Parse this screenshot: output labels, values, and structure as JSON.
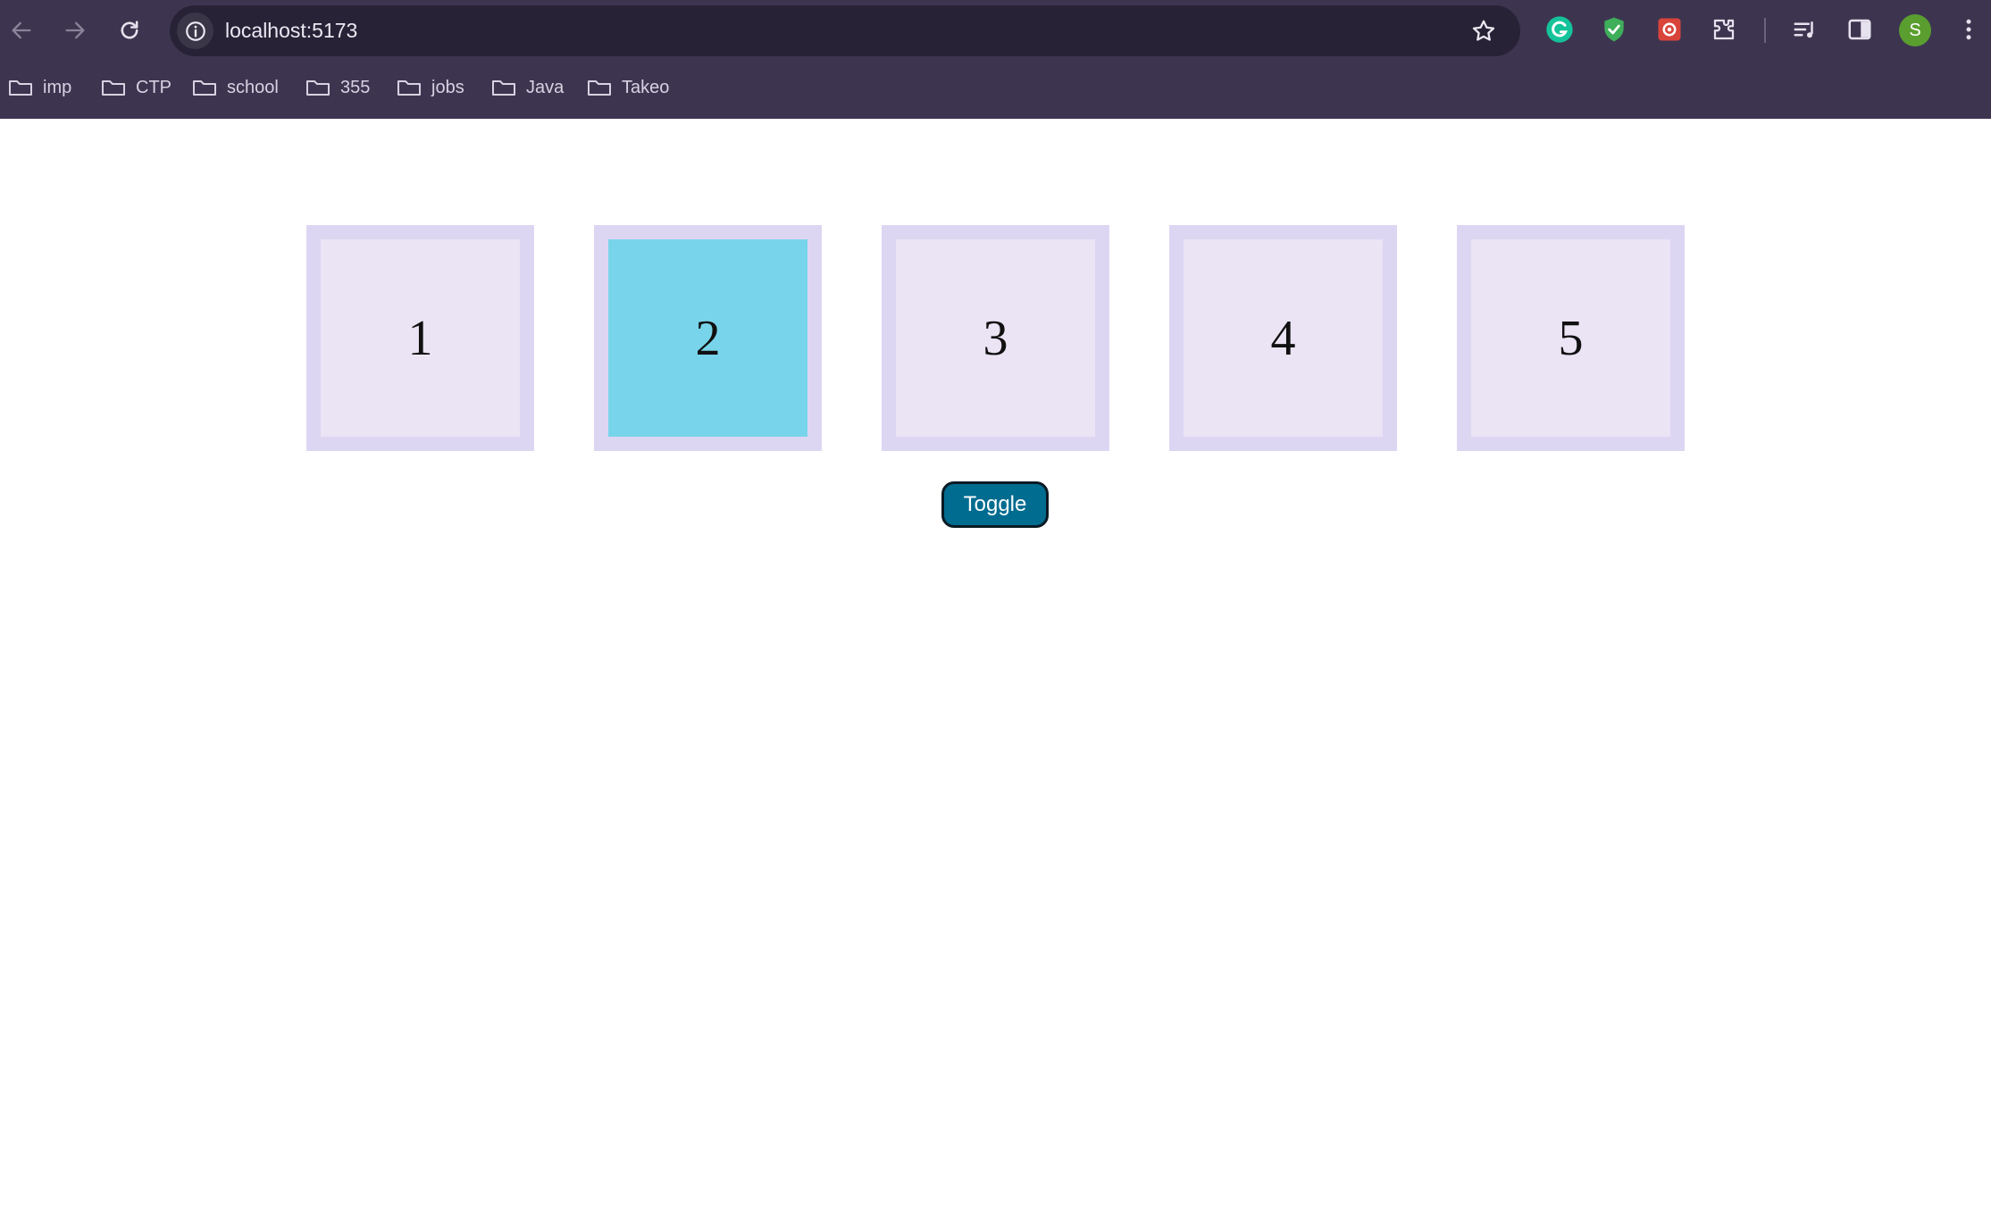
{
  "browser": {
    "url": "localhost:5173",
    "profile_initial": "S",
    "icons": [
      "back-arrow-icon",
      "forward-arrow-icon",
      "reload-icon",
      "site-info-icon",
      "bookmark-star-icon",
      "grammarly-icon",
      "shield-extension-icon",
      "red-extension-icon",
      "extensions-puzzle-icon",
      "reading-list-icon",
      "side-panel-icon",
      "menu-kebab-icon"
    ],
    "bookmarks": [
      {
        "label": "imp"
      },
      {
        "label": "CTP"
      },
      {
        "label": "school"
      },
      {
        "label": "355"
      },
      {
        "label": "jobs"
      },
      {
        "label": "Java"
      },
      {
        "label": "Takeo"
      }
    ]
  },
  "boxes": [
    {
      "label": "1",
      "active": false
    },
    {
      "label": "2",
      "active": true
    },
    {
      "label": "3",
      "active": false
    },
    {
      "label": "4",
      "active": false
    },
    {
      "label": "5",
      "active": false
    }
  ],
  "toggle_label": "Toggle",
  "colors": {
    "chrome_bg": "#3d3550",
    "omnibox_bg": "#282236",
    "box_border": "#ddd6f3",
    "box_fill": "#ebe4f5",
    "box_active_fill": "#78d4ea",
    "button_bg": "#006c90"
  }
}
